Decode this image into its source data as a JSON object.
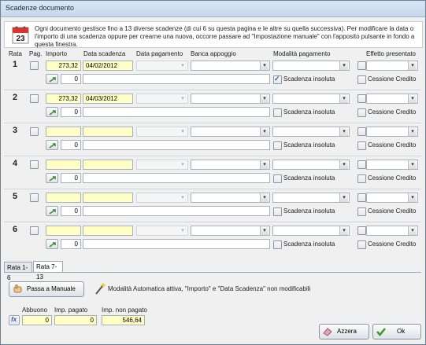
{
  "window": {
    "title": "Scadenze documento"
  },
  "info": {
    "text": "Ogni documento gestisce fino a 13 diverse scadenze (di cui 6 su questa pagina e le altre su quella successiva). Per modificare la data o l'importo di una scadenza oppure per crearne una nuova, occorre passare ad \"Impostazione manuale\" con l'apposito pulsante in fondo a questa finestra."
  },
  "headers": {
    "rata": "Rata",
    "pag": "Pag.",
    "importo": "Importo",
    "data_scadenza": "Data scadenza",
    "data_pagamento": "Data pagamento",
    "banca": "Banca appoggio",
    "modalita": "Modalità pagamento",
    "effetto": "Effetto presentato"
  },
  "rows": [
    {
      "num": "1",
      "importo": "273,32",
      "data_scadenza": "04/02/2012",
      "secondary": "0",
      "insoluta_label": "Scadenza insoluta",
      "insoluta_checked": true,
      "cessione_label": "Cessione Credito"
    },
    {
      "num": "2",
      "importo": "273,32",
      "data_scadenza": "04/03/2012",
      "secondary": "0",
      "insoluta_label": "Scadenza insoluta",
      "insoluta_checked": false,
      "cessione_label": "Cessione Credito"
    },
    {
      "num": "3",
      "importo": "",
      "data_scadenza": "",
      "secondary": "0",
      "insoluta_label": "Scadenza insoluta",
      "insoluta_checked": false,
      "cessione_label": "Cessione Credito"
    },
    {
      "num": "4",
      "importo": "",
      "data_scadenza": "",
      "secondary": "0",
      "insoluta_label": "Scadenza insoluta",
      "insoluta_checked": false,
      "cessione_label": "Cessione Credito"
    },
    {
      "num": "5",
      "importo": "",
      "data_scadenza": "",
      "secondary": "0",
      "insoluta_label": "Scadenza insoluta",
      "insoluta_checked": false,
      "cessione_label": "Cessione Credito"
    },
    {
      "num": "6",
      "importo": "",
      "data_scadenza": "",
      "secondary": "0",
      "insoluta_label": "Scadenza insoluta",
      "insoluta_checked": false,
      "cessione_label": "Cessione Credito"
    }
  ],
  "tabs": [
    "Rata 1-6",
    "Rata 7-13"
  ],
  "manual": {
    "button": "Passa a Manuale",
    "note": "Modalità Automatica attiva, \"Importo\" e \"Data Scadenza\" non modificabili"
  },
  "totals": {
    "abbuono_label": "Abbuono",
    "abbuono": "0",
    "pagato_label": "Imp. pagato",
    "pagato": "0",
    "non_pagato_label": "Imp. non pagato",
    "non_pagato": "546,64",
    "fx_label": "fx"
  },
  "buttons": {
    "azzera": "Azzera",
    "ok": "Ok"
  },
  "colors": {
    "highlight": "#ffffc6",
    "accent": "#2a5d9e"
  }
}
